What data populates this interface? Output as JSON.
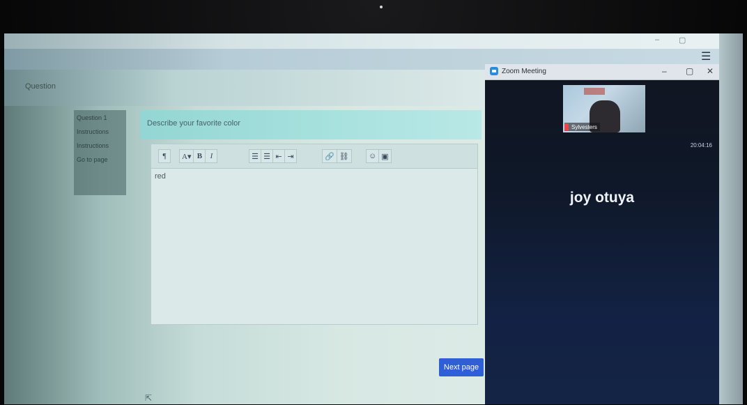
{
  "browser": {
    "window_controls": {
      "minimize": "–",
      "maximize": "▢"
    },
    "menu_icon": "hamburger-menu-icon",
    "header_text": "Question"
  },
  "left_nav": {
    "items": [
      "Question 1",
      "Instructions",
      "Instructions",
      "Go to page"
    ]
  },
  "form": {
    "question": "Describe your favorite color",
    "toolbar": {
      "buttons": [
        {
          "icon": "paragraph-format-icon",
          "label": "¶"
        },
        {
          "icon": "font-color-icon",
          "label": "A▾"
        },
        {
          "icon": "bold-icon",
          "label": "B"
        },
        {
          "icon": "italic-icon",
          "label": "I"
        },
        {
          "icon": "bullet-list-icon",
          "label": "☰"
        },
        {
          "icon": "numbered-list-icon",
          "label": "☰"
        },
        {
          "icon": "outdent-icon",
          "label": "⇤"
        },
        {
          "icon": "indent-icon",
          "label": "⇥"
        },
        {
          "icon": "link-icon",
          "label": "🔗"
        },
        {
          "icon": "unlink-icon",
          "label": "⛓"
        },
        {
          "icon": "emoji-icon",
          "label": "☺"
        },
        {
          "icon": "image-icon",
          "label": "▣"
        }
      ]
    },
    "answer_text": "red",
    "next_button_label": "Next page"
  },
  "zoom": {
    "window_title": "Zoom Meeting",
    "window_controls": {
      "minimize": "–",
      "maximize": "▢",
      "close": "✕"
    },
    "thumbnail_name": "Sylvesters",
    "meeting_time": "20:04:16",
    "active_participant": "joy otuya"
  },
  "colors": {
    "next_button": "#2e5fd6",
    "zoom_background": "#132244",
    "question_bar": "#a9e2df"
  }
}
